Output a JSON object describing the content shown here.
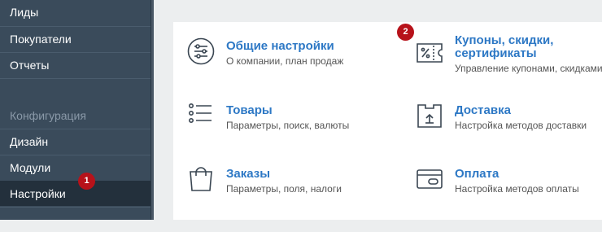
{
  "sidebar": {
    "items_top": [
      {
        "label": "Лиды"
      },
      {
        "label": "Покупатели"
      },
      {
        "label": "Отчеты"
      }
    ],
    "section_header": "Конфигурация",
    "items_bottom": [
      {
        "label": "Дизайн"
      },
      {
        "label": "Модули"
      },
      {
        "label": "Настройки"
      }
    ]
  },
  "cards": [
    {
      "title": "Общие настройки",
      "subtitle": "О компании, план продаж",
      "icon": "sliders-icon"
    },
    {
      "title": "Купоны, скидки, сертификаты",
      "title_line1": "Купоны, скидки,",
      "title_line2": "сертификаты",
      "subtitle": "Управление купонами, скидками",
      "icon": "coupon-icon"
    },
    {
      "title": "Товары",
      "subtitle": "Параметры, поиск, валюты",
      "icon": "list-icon"
    },
    {
      "title": "Доставка",
      "subtitle": "Настройка методов доставки",
      "icon": "delivery-box-icon"
    },
    {
      "title": "Заказы",
      "subtitle": "Параметры, поля, налоги",
      "icon": "shopping-bag-icon"
    },
    {
      "title": "Оплата",
      "subtitle": "Настройка методов оплаты",
      "icon": "credit-card-icon"
    }
  ],
  "badges": [
    "1",
    "2"
  ],
  "colors": {
    "sidebar_bg": "#3a4b5b",
    "sidebar_active": "#23303c",
    "link": "#2d78c5",
    "badge": "#b7121a"
  }
}
